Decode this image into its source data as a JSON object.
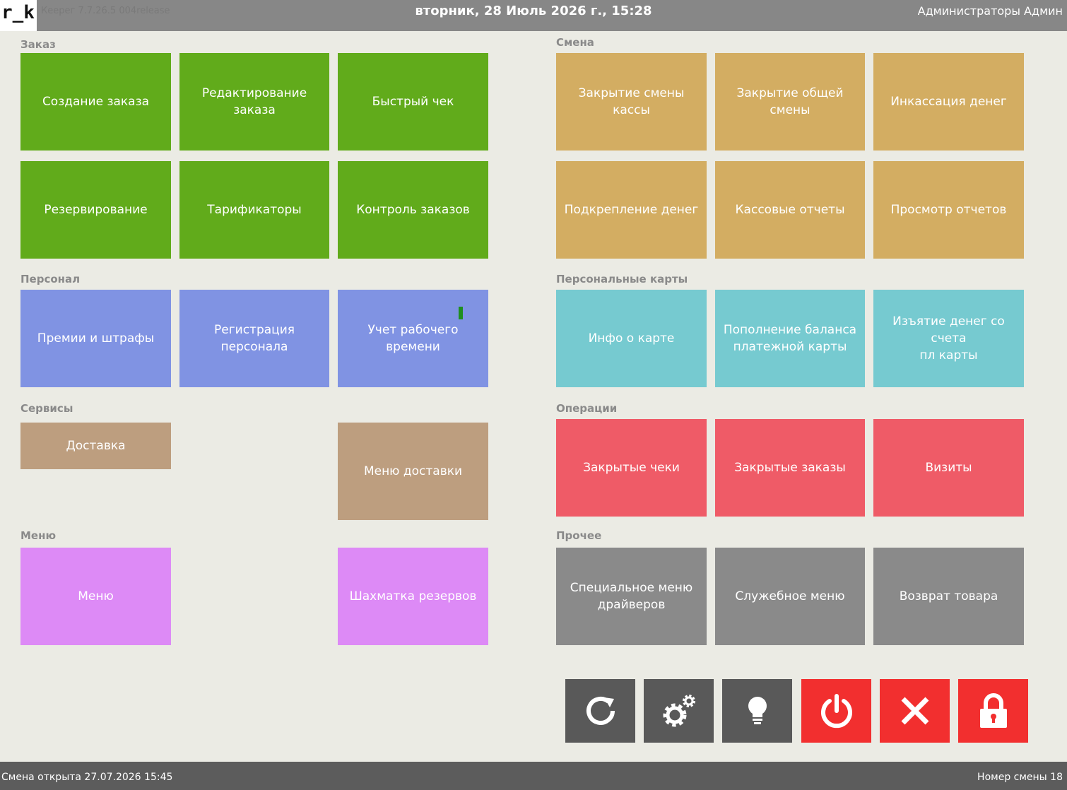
{
  "header": {
    "logo": "r_k",
    "version": "Кеерег 7.7.26.5 004release",
    "datetime": "вторник, 28 Июль 2026 г., 15:28",
    "user": "Администраторы Админ"
  },
  "sections": {
    "order": "Заказ",
    "shift": "Смена",
    "staff": "Персонал",
    "cards": "Персональные карты",
    "services": "Сервисы",
    "operations": "Операции",
    "menu": "Меню",
    "other": "Прочее"
  },
  "tiles": {
    "create_order": "Создание заказа",
    "edit_order": "Редактирование заказа",
    "quick_check": "Быстрый чек",
    "reservation": "Резервирование",
    "tariffs": "Тарификаторы",
    "order_control": "Контроль заказов",
    "close_cash_shift": "Закрытие смены кассы",
    "close_general_shift": "Закрытие общей смены",
    "cash_collection": "Инкассация денег",
    "cash_reinforcement": "Подкрепление денег",
    "cash_reports": "Кассовые отчеты",
    "view_reports": "Просмотр отчетов",
    "bonuses_fines": "Премии и штрафы",
    "staff_registration": "Регистрация персонала",
    "work_time": "Учет рабочего времени",
    "card_info": "Инфо о карте",
    "topup_line1": "Пополнение баланса",
    "topup_line2": "платежной карты",
    "withdraw_line1": "Изъятие денег со счета",
    "withdraw_line2": "пл карты",
    "delivery": "Доставка",
    "delivery_menu": "Меню доставки",
    "closed_checks": "Закрытые чеки",
    "closed_orders": "Закрытые заказы",
    "visits": "Визиты",
    "menu": "Меню",
    "reservation_chess": "Шахматка резервов",
    "driver_menu_line1": "Специальное меню",
    "driver_menu_line2": "драйверов",
    "service_menu": "Служебное меню",
    "return_goods": "Возврат товара"
  },
  "actions": [
    {
      "icon": "refresh-icon"
    },
    {
      "icon": "gears-icon"
    },
    {
      "icon": "lightbulb-icon"
    },
    {
      "icon": "power-icon"
    },
    {
      "icon": "close-icon"
    },
    {
      "icon": "lock-icon"
    }
  ],
  "status": {
    "shift_opened": "Смена открыта 27.07.2026 15:45",
    "shift_number": "Номер смены 18"
  },
  "colors": {
    "green": "#61ab1b",
    "tan": "#d3ad62",
    "blue": "#8093e3",
    "teal": "#76cad0",
    "brown": "#bd9e7f",
    "red": "#ef5b67",
    "purple": "#dd8af6",
    "grey": "#8a8a8a",
    "action_dark": "#595959",
    "action_red": "#f22f2f"
  }
}
